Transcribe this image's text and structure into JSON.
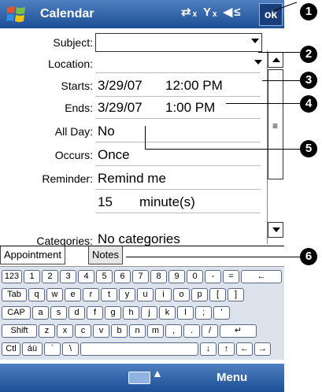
{
  "app": {
    "title": "Calendar",
    "ok_label": "ok",
    "status_icons": "⇄ₓ Yₓ ◀≤"
  },
  "form": {
    "subject_label": "Subject:",
    "location_label": "Location:",
    "starts_label": "Starts:",
    "starts_date": "3/29/07",
    "starts_time": "12:00 PM",
    "ends_label": "Ends:",
    "ends_date": "3/29/07",
    "ends_time": "1:00 PM",
    "allday_label": "All Day:",
    "allday_value": "No",
    "occurs_label": "Occurs:",
    "occurs_value": "Once",
    "reminder_label": "Reminder:",
    "reminder_value": "Remind me",
    "reminder_amount": "15",
    "reminder_unit": "minute(s)",
    "categories_label": "Categories:",
    "categories_value": "No categories"
  },
  "tabs": {
    "appointment": "Appointment",
    "notes": "Notes"
  },
  "keyboard": {
    "row1": [
      "123",
      "1",
      "2",
      "3",
      "4",
      "5",
      "6",
      "7",
      "8",
      "9",
      "0",
      "-",
      "=",
      "←"
    ],
    "row2": [
      "Tab",
      "q",
      "w",
      "e",
      "r",
      "t",
      "y",
      "u",
      "i",
      "o",
      "p",
      "[",
      "]"
    ],
    "row3": [
      "CAP",
      "a",
      "s",
      "d",
      "f",
      "g",
      "h",
      "j",
      "k",
      "l",
      ";",
      "'"
    ],
    "row4": [
      "Shift",
      "z",
      "x",
      "c",
      "v",
      "b",
      "n",
      "m",
      ",",
      ".",
      "/",
      "↵"
    ],
    "row5": [
      "Ctl",
      "áü",
      "`",
      "\\",
      "",
      "↓",
      "↑",
      "←",
      "→"
    ]
  },
  "menubar": {
    "menu_label": "Menu"
  },
  "callouts": [
    "1",
    "2",
    "3",
    "4",
    "5",
    "6"
  ]
}
